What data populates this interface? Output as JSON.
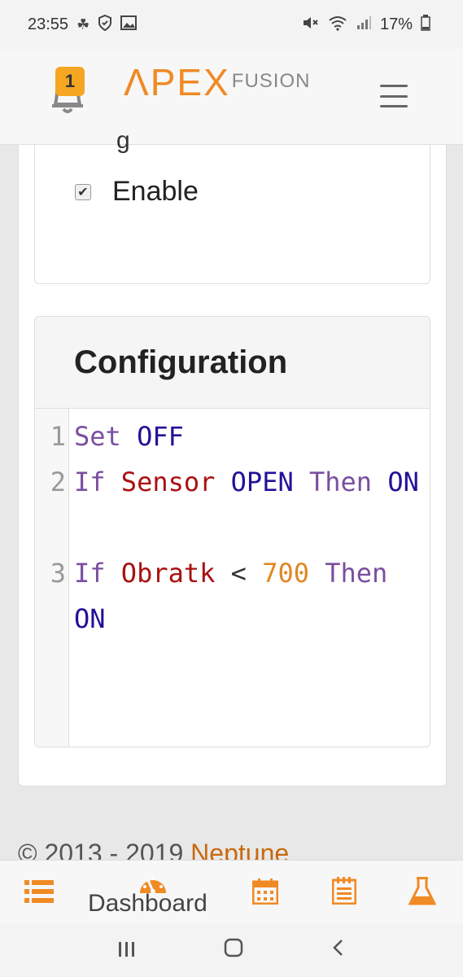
{
  "status_bar": {
    "time": "23:55",
    "battery": "17%",
    "left_icons": [
      "notification-icon",
      "shield-icon",
      "image-icon"
    ],
    "right_icons": [
      "mute-icon",
      "wifi-icon",
      "signal-icon",
      "battery-icon"
    ]
  },
  "header": {
    "notification_count": "1",
    "logo_main": "ΛPEX",
    "logo_sub": "FUSION"
  },
  "enable_card": {
    "partial_text": "g",
    "checkbox_checked": true,
    "checkbox_mark": "✔",
    "label": "Enable"
  },
  "config": {
    "title": "Configuration",
    "lines": [
      {
        "num": "1",
        "tokens": [
          {
            "t": "Set",
            "c": "kw"
          },
          {
            "t": " ",
            "c": "op"
          },
          {
            "t": "OFF",
            "c": "atom"
          }
        ]
      },
      {
        "num": "2",
        "tokens": [
          {
            "t": "If",
            "c": "kw"
          },
          {
            "t": " ",
            "c": "op"
          },
          {
            "t": "Sensor",
            "c": "var"
          },
          {
            "t": " ",
            "c": "op"
          },
          {
            "t": "OPEN",
            "c": "atom"
          },
          {
            "t": " ",
            "c": "op"
          },
          {
            "t": "Then",
            "c": "kw"
          },
          {
            "t": " ",
            "c": "op"
          },
          {
            "t": "ON",
            "c": "atom"
          }
        ]
      },
      {
        "num": "3",
        "tokens": [
          {
            "t": "If",
            "c": "kw"
          },
          {
            "t": " ",
            "c": "op"
          },
          {
            "t": "Obratk",
            "c": "var"
          },
          {
            "t": " < ",
            "c": "op"
          },
          {
            "t": "700",
            "c": "num"
          },
          {
            "t": " ",
            "c": "op"
          },
          {
            "t": "Then",
            "c": "kw"
          },
          {
            "t": " ",
            "c": "op"
          },
          {
            "t": "ON",
            "c": "atom"
          }
        ]
      }
    ]
  },
  "footer": {
    "copyright": "© 2013 - 2019 ",
    "company": "Neptune"
  },
  "bottom_nav": {
    "active_label": "Dashboard",
    "items": [
      "list-icon",
      "dashboard-icon",
      "calendar-icon",
      "notepad-icon",
      "flask-icon"
    ]
  },
  "colors": {
    "accent": "#f08a24",
    "keyword": "#7a4fa0",
    "atom": "#221199",
    "variable": "#aa1111",
    "number": "#e0871f"
  }
}
